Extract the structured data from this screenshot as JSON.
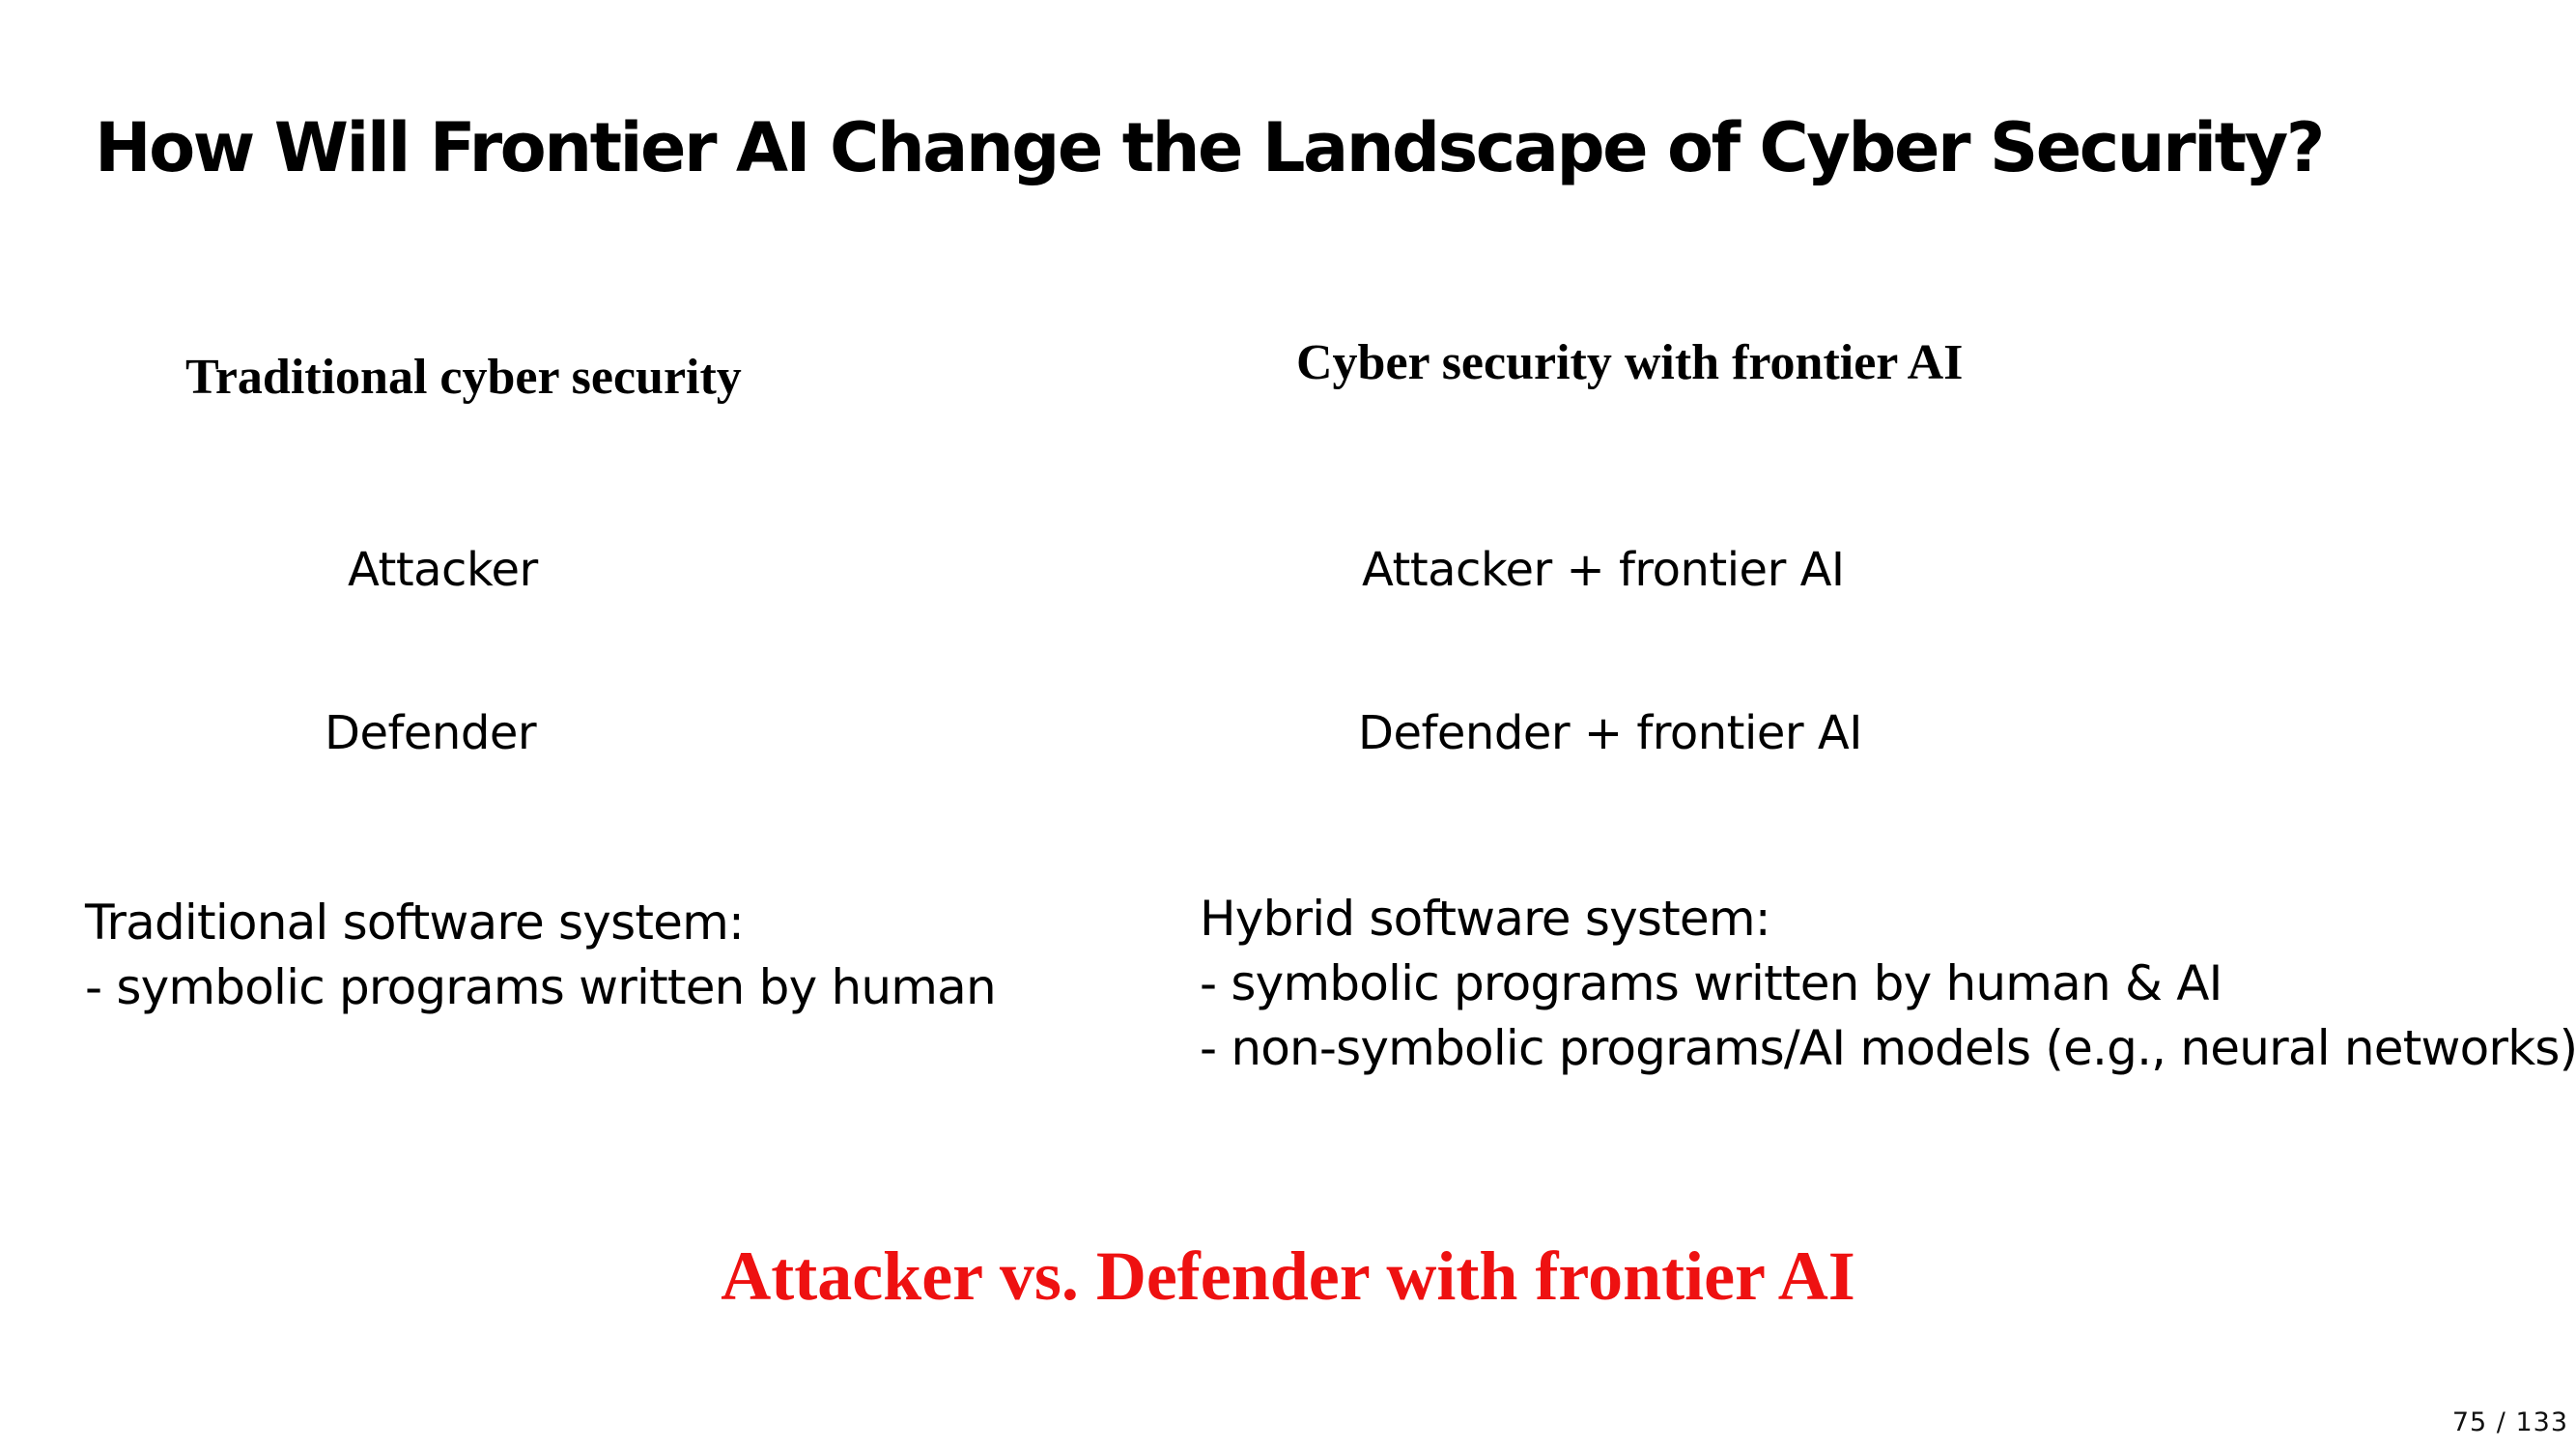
{
  "slide": {
    "title": "How Will Frontier AI Change the Landscape of Cyber Security?",
    "left_column": {
      "heading": "Traditional cyber security",
      "attacker": "Attacker",
      "defender": "Defender",
      "system_lines": [
        "Traditional software system:",
        "- symbolic programs written by human"
      ]
    },
    "right_column": {
      "heading": "Cyber security with frontier AI",
      "attacker": "Attacker + frontier AI",
      "defender": "Defender + frontier AI",
      "system_lines": [
        "Hybrid software system:",
        "- symbolic programs written by human & AI",
        "- non-symbolic programs/AI models (e.g., neural networks)"
      ]
    },
    "conclusion": "Attacker vs. Defender with frontier AI",
    "conclusion_color": "#ee1111"
  },
  "viewer": {
    "page_counter": "75 / 133"
  }
}
